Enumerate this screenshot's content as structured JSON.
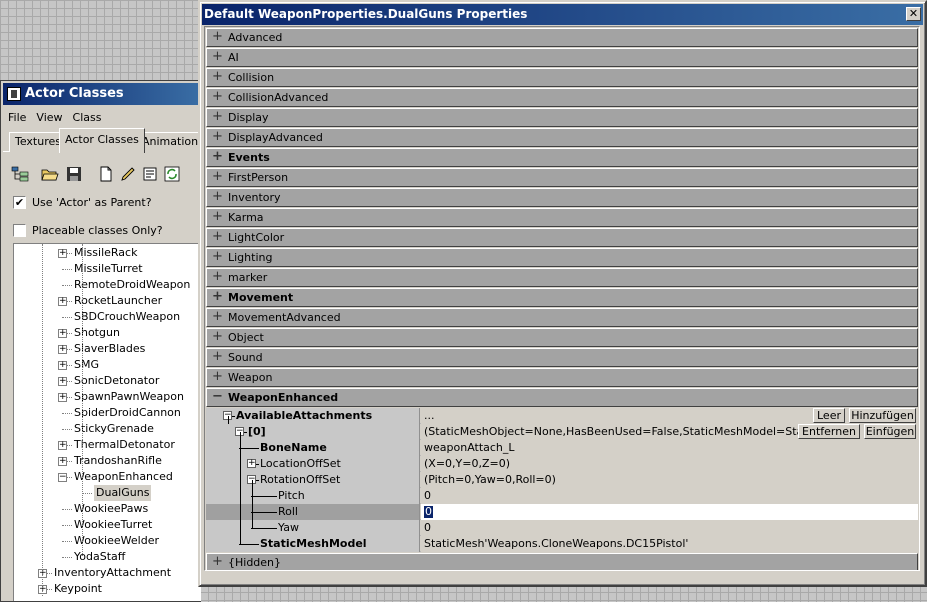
{
  "actor_window": {
    "title": "Actor Classes",
    "menu": [
      "File",
      "View",
      "Class"
    ],
    "tabs": [
      "Textures",
      "Actor Classes",
      "Animations"
    ],
    "toolbar_icons": [
      "tree-view-icon",
      "open-folder-icon",
      "save-icon",
      "new-document-icon",
      "pencil-icon",
      "properties-icon",
      "refresh-icon"
    ],
    "use_actor_parent": {
      "label": "Use 'Actor' as Parent?",
      "checked": true
    },
    "placeable_only": {
      "label": "Placeable classes Only?",
      "checked": false
    },
    "tree": [
      {
        "label": "MissileRack",
        "expander": true,
        "indent": 2
      },
      {
        "label": "MissileTurret",
        "expander": false,
        "indent": 2
      },
      {
        "label": "RemoteDroidWeapon",
        "expander": false,
        "indent": 2
      },
      {
        "label": "RocketLauncher",
        "expander": true,
        "indent": 2
      },
      {
        "label": "SBDCrouchWeapon",
        "expander": false,
        "indent": 2
      },
      {
        "label": "Shotgun",
        "expander": true,
        "indent": 2
      },
      {
        "label": "SlaverBlades",
        "expander": true,
        "indent": 2
      },
      {
        "label": "SMG",
        "expander": true,
        "indent": 2
      },
      {
        "label": "SonicDetonator",
        "expander": true,
        "indent": 2
      },
      {
        "label": "SpawnPawnWeapon",
        "expander": true,
        "indent": 2
      },
      {
        "label": "SpiderDroidCannon",
        "expander": false,
        "indent": 2
      },
      {
        "label": "StickyGrenade",
        "expander": false,
        "indent": 2
      },
      {
        "label": "ThermalDetonator",
        "expander": true,
        "indent": 2
      },
      {
        "label": "TrandoshanRifle",
        "expander": true,
        "indent": 2
      },
      {
        "label": "WeaponEnhanced",
        "expander": true,
        "expanded": true,
        "indent": 2
      },
      {
        "label": "DualGuns",
        "expander": false,
        "indent": 3,
        "selected": true
      },
      {
        "label": "WookieePaws",
        "expander": false,
        "indent": 2
      },
      {
        "label": "WookieeTurret",
        "expander": false,
        "indent": 2
      },
      {
        "label": "WookieeWelder",
        "expander": false,
        "indent": 2
      },
      {
        "label": "YodaStaff",
        "expander": false,
        "indent": 2
      },
      {
        "label": "InventoryAttachment",
        "expander": true,
        "indent": 0
      },
      {
        "label": "Keypoint",
        "expander": true,
        "indent": 0
      }
    ]
  },
  "props_window": {
    "title": "Default WeaponProperties.DualGuns Properties",
    "close_glyph": "✕",
    "categories_top": [
      {
        "label": "Advanced",
        "bold": false
      },
      {
        "label": "AI",
        "bold": false
      },
      {
        "label": "Collision",
        "bold": false
      },
      {
        "label": "CollisionAdvanced",
        "bold": false
      },
      {
        "label": "Display",
        "bold": false
      },
      {
        "label": "DisplayAdvanced",
        "bold": false
      },
      {
        "label": "Events",
        "bold": true
      },
      {
        "label": "FirstPerson",
        "bold": false
      },
      {
        "label": "Inventory",
        "bold": false
      },
      {
        "label": "Karma",
        "bold": false
      },
      {
        "label": "LightColor",
        "bold": false
      },
      {
        "label": "Lighting",
        "bold": false
      },
      {
        "label": "marker",
        "bold": false
      },
      {
        "label": "Movement",
        "bold": true
      },
      {
        "label": "MovementAdvanced",
        "bold": false
      },
      {
        "label": "Object",
        "bold": false
      },
      {
        "label": "Sound",
        "bold": false
      },
      {
        "label": "Weapon",
        "bold": false
      },
      {
        "label": "WeaponEnhanced",
        "bold": true,
        "expanded": true
      }
    ],
    "properties": [
      {
        "name": "AvailableAttachments",
        "value": "...",
        "level": 0,
        "expander": "minus",
        "bold": true,
        "buttons": [
          "Leer",
          "Hinzufügen"
        ]
      },
      {
        "name": "[0]",
        "value": "(StaticMeshObject=None,HasBeenUsed=False,StaticMeshModel=StaticMes...",
        "level": 1,
        "expander": "minus",
        "bold": true,
        "buttons": [
          "Entfernen",
          "Einfügen"
        ]
      },
      {
        "name": "BoneName",
        "value": "weaponAttach_L",
        "level": 2,
        "expander": "none",
        "bold": true
      },
      {
        "name": "LocationOffSet",
        "value": "(X=0,Y=0,Z=0)",
        "level": 2,
        "expander": "plus",
        "bold": false
      },
      {
        "name": "RotationOffSet",
        "value": "(Pitch=0,Yaw=0,Roll=0)",
        "level": 2,
        "expander": "minus",
        "bold": false
      },
      {
        "name": "Pitch",
        "value": "0",
        "level": 3,
        "expander": "none",
        "bold": false
      },
      {
        "name": "Roll",
        "value": "0",
        "level": 3,
        "expander": "none",
        "bold": false,
        "selected": true
      },
      {
        "name": "Yaw",
        "value": "0",
        "level": 3,
        "expander": "none",
        "bold": false
      },
      {
        "name": "StaticMeshModel",
        "value": "StaticMesh'Weapons.CloneWeapons.DC15Pistol'",
        "level": 2,
        "expander": "none",
        "bold": true
      }
    ],
    "categories_bottom": [
      {
        "label": "{Hidden}",
        "bold": false
      }
    ]
  }
}
